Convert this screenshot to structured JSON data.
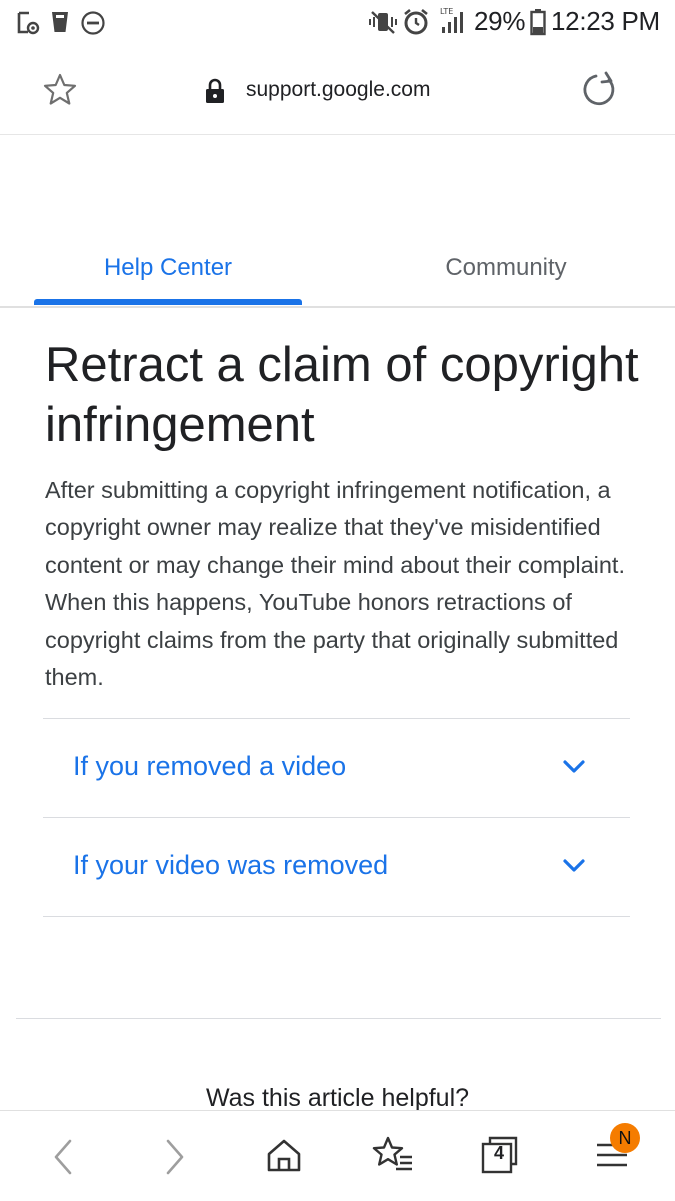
{
  "status_bar": {
    "battery_percent": "29%",
    "time": "12:23 PM",
    "network": "LTE",
    "icons": [
      "screenshot-icon",
      "trash-icon",
      "do-not-disturb-icon",
      "vibrate-icon",
      "alarm-icon",
      "signal-icon",
      "battery-icon"
    ]
  },
  "browser": {
    "url": "support.google.com",
    "icons": [
      "bookmark-star-icon",
      "lock-icon",
      "reload-icon"
    ]
  },
  "tabs": {
    "help_center": "Help Center",
    "community": "Community",
    "active": "help_center"
  },
  "article": {
    "title": "Retract a claim of copyright infringement",
    "intro": "After submitting a copyright infringement notification, a copyright owner may realize that they've misidentified content or may change their mind about their complaint. When this happens, YouTube honors retractions of copyright claims from the party that originally submitted them.",
    "sections": [
      {
        "label": "If you removed a video"
      },
      {
        "label": "If your video was removed"
      }
    ]
  },
  "feedback": {
    "question": "Was this article helpful?"
  },
  "bottom_nav": {
    "tab_count": "4",
    "menu_badge": "N",
    "icons": [
      "back-icon",
      "forward-icon",
      "home-icon",
      "bookmarks-icon",
      "tabs-icon",
      "menu-icon"
    ]
  },
  "colors": {
    "accent": "#1a73e8",
    "badge": "#f57c00"
  }
}
